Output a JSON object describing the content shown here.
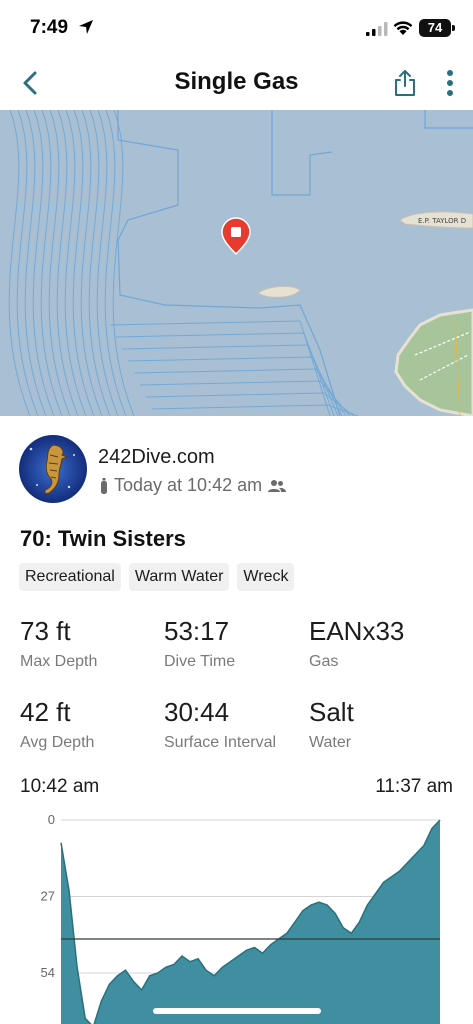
{
  "status_bar": {
    "time": "7:49",
    "battery": "74"
  },
  "nav": {
    "title": "Single Gas",
    "back_icon": "chevron-left-icon",
    "share_icon": "share-icon",
    "more_icon": "more-vertical-icon"
  },
  "map": {
    "road_label": "E.P. TAYLOR D"
  },
  "profile": {
    "account_name": "242Dive.com",
    "datetime": "Today at 10:42 am"
  },
  "dive": {
    "title": "70: Twin Sisters",
    "tags": [
      "Recreational",
      "Warm Water",
      "Wreck"
    ]
  },
  "stats": [
    {
      "value": "73 ft",
      "label": "Max Depth"
    },
    {
      "value": "53:17",
      "label": "Dive Time"
    },
    {
      "value": "EANx33",
      "label": "Gas"
    },
    {
      "value": "42 ft",
      "label": "Avg Depth"
    },
    {
      "value": "30:44",
      "label": "Surface Interval"
    },
    {
      "value": "Salt",
      "label": "Water"
    }
  ],
  "timeline": {
    "start": "10:42 am",
    "end": "11:37 am"
  },
  "chart_data": {
    "type": "area",
    "y_ticks": [
      "0",
      "27",
      "54"
    ],
    "ylim": [
      0,
      80
    ],
    "y_inverted": true,
    "avg_depth": 42,
    "x_minutes": [
      0,
      1,
      2,
      3,
      4,
      5,
      6,
      7,
      8,
      9,
      10,
      11,
      12,
      13,
      14,
      15,
      16,
      17,
      18,
      19,
      20,
      21,
      22,
      23,
      24,
      25,
      26,
      27,
      28,
      29,
      30,
      31,
      32,
      33,
      34,
      35,
      36,
      37,
      38,
      39,
      40,
      41,
      42,
      43,
      44,
      45,
      46,
      47,
      48,
      49,
      50,
      51,
      52,
      53,
      54,
      55
    ],
    "depth_ft": [
      8,
      25,
      52,
      70,
      73,
      64,
      58,
      55,
      53,
      57,
      60,
      55,
      54,
      52,
      51,
      48,
      50,
      49,
      53,
      55,
      52,
      50,
      48,
      46,
      45,
      47,
      44,
      42,
      40,
      36,
      32,
      30,
      29,
      30,
      33,
      38,
      40,
      36,
      30,
      26,
      22,
      20,
      18,
      15,
      12,
      9,
      3,
      0,
      null,
      null,
      null,
      null,
      null,
      null,
      null,
      null
    ],
    "color": "#3f8fa0"
  },
  "colors": {
    "accent": "#2b6f80",
    "map_water": "#a9bfd4",
    "map_land": "#a8c49a",
    "pin": "#e63b2e"
  }
}
